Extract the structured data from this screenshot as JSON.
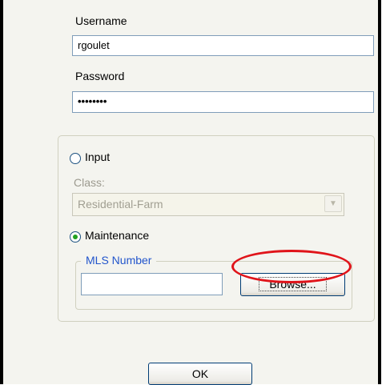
{
  "login": {
    "username_label": "Username",
    "username_value": "rgoulet",
    "password_label": "Password",
    "password_mask": "••••••••"
  },
  "mode": {
    "input_label": "Input",
    "input_selected": false,
    "class_label": "Class:",
    "class_value": "Residential-Farm",
    "maintenance_label": "Maintenance",
    "maintenance_selected": true
  },
  "mls": {
    "group_label": "MLS Number",
    "value": "",
    "browse_label": "Browse..."
  },
  "footer": {
    "ok_label": "OK"
  },
  "colors": {
    "annotation": "#e0141a",
    "group_legend": "#2255cc",
    "radio_selected": "#21a121"
  }
}
